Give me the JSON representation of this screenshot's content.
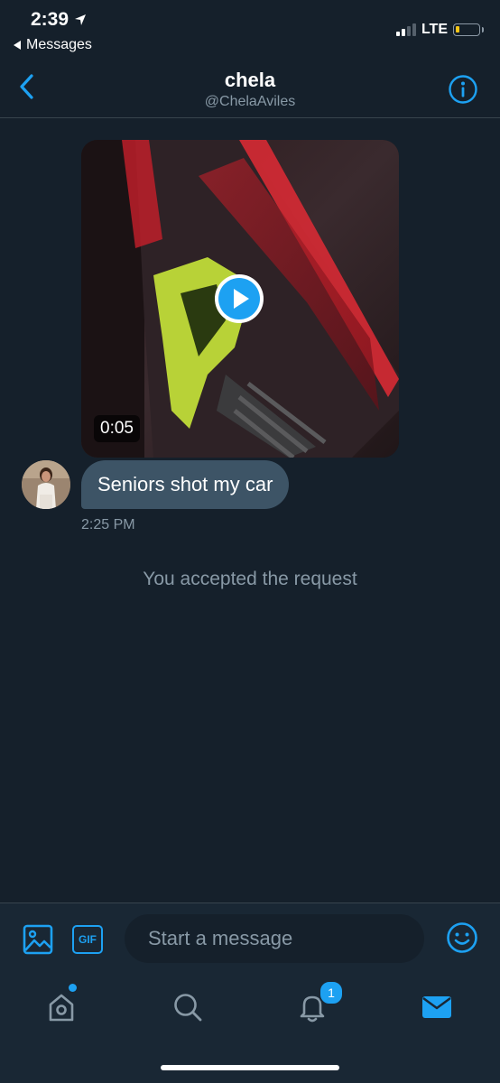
{
  "status_bar": {
    "time": "2:39",
    "back_app": "Messages",
    "network": "LTE"
  },
  "header": {
    "name": "chela",
    "handle": "@ChelaAviles"
  },
  "conversation": {
    "video": {
      "duration": "0:05"
    },
    "messages": [
      {
        "text": "Seniors shot my car",
        "time": "2:25 PM"
      }
    ],
    "system_note": "You accepted the request"
  },
  "composer": {
    "gif_label": "GIF",
    "placeholder": "Start a message"
  },
  "tab_bar": {
    "notifications_badge": "1"
  },
  "colors": {
    "background": "#15202b",
    "accent": "#1da1f2",
    "bubble": "#3d5466",
    "muted_text": "#8899a6",
    "divider": "#38444d"
  },
  "icons": {
    "back": "chevron-left-icon",
    "info": "info-icon",
    "play": "play-icon",
    "media": "image-icon",
    "emoji": "smiley-icon",
    "home": "home-icon",
    "search": "search-icon",
    "notifications": "bell-icon",
    "messages": "mail-icon"
  }
}
